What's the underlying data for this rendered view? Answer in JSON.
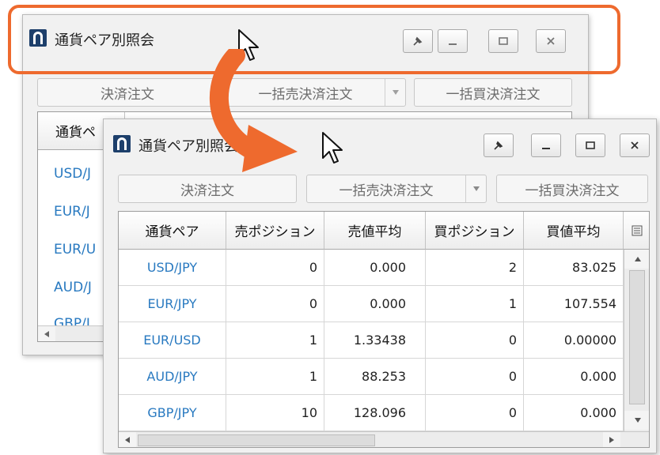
{
  "back_window": {
    "title": "通貨ペア別照会",
    "buttons": {
      "close_order": "決済注文",
      "bulk_sell_close": "一括売決済注文",
      "bulk_buy_close": "一括買決済注文"
    },
    "visible_header": "通貨ペ",
    "visible_pairs": [
      "USD/J",
      "EUR/J",
      "EUR/U",
      "AUD/J",
      "GBP/J"
    ]
  },
  "front_window": {
    "title": "通貨ペア別照会",
    "buttons": {
      "close_order": "決済注文",
      "bulk_sell_close": "一括売決済注文",
      "bulk_buy_close": "一括買決済注文"
    },
    "table": {
      "columns": [
        "通貨ペア",
        "売ポジション",
        "売値平均",
        "買ポジション",
        "買値平均"
      ],
      "rows": [
        {
          "pair": "USD/JPY",
          "sell_pos": "0",
          "sell_avg": "0.000",
          "buy_pos": "2",
          "buy_avg": "83.025"
        },
        {
          "pair": "EUR/JPY",
          "sell_pos": "0",
          "sell_avg": "0.000",
          "buy_pos": "1",
          "buy_avg": "107.554"
        },
        {
          "pair": "EUR/USD",
          "sell_pos": "1",
          "sell_avg": "1.33438",
          "buy_pos": "0",
          "buy_avg": "0.00000"
        },
        {
          "pair": "AUD/JPY",
          "sell_pos": "1",
          "sell_avg": "88.253",
          "buy_pos": "0",
          "buy_avg": "0.000"
        },
        {
          "pair": "GBP/JPY",
          "sell_pos": "10",
          "sell_avg": "128.096",
          "buy_pos": "0",
          "buy_avg": "0.000"
        }
      ]
    }
  },
  "colors": {
    "highlight": "#ee6a2e",
    "pair_link": "#2879c0",
    "logo": "#1d3f6b"
  },
  "icons": [
    "pin-icon",
    "minimize-icon",
    "maximize-icon",
    "close-icon",
    "cursor-icon",
    "column-menu-icon",
    "scroll-arrow-icons",
    "curved-arrow-icon"
  ]
}
